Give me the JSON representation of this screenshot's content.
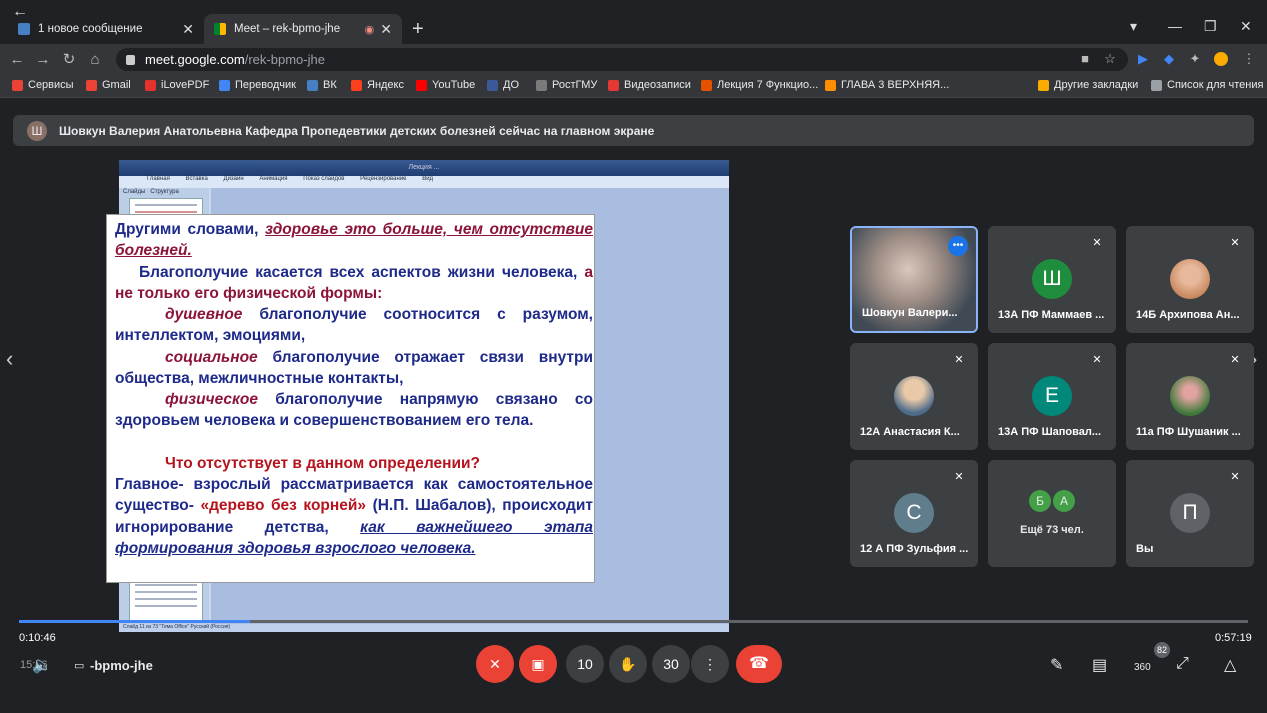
{
  "browser": {
    "tabs": [
      {
        "title": "1 новое сообщение",
        "favicon": "vk-icon",
        "color": "#4680c2"
      },
      {
        "title": "Meet – rek-bpmo-jhe",
        "favicon": "meet-icon",
        "color": "#00897b",
        "active": true
      }
    ],
    "url_host": "meet.google.com",
    "url_path": "/rek-bpmo-jhe",
    "bookmarks": [
      {
        "label": "Сервисы",
        "color": "#ea4335"
      },
      {
        "label": "Gmail",
        "color": "#ea4335"
      },
      {
        "label": "iLovePDF",
        "color": "#e5322d"
      },
      {
        "label": "Переводчик",
        "color": "#4285f4"
      },
      {
        "label": "ВК",
        "color": "#4680c2"
      },
      {
        "label": "Яндекс",
        "color": "#fc3f1d"
      },
      {
        "label": "YouTube",
        "color": "#ff0000"
      },
      {
        "label": "ДО",
        "color": "#3b5998"
      },
      {
        "label": "РостГМУ",
        "color": "#7a7a7a"
      },
      {
        "label": "Видеозаписи",
        "color": "#e53935"
      },
      {
        "label": "Лекция 7 Функцио...",
        "color": "#e65100"
      },
      {
        "label": "ГЛАВА 3 ВЕРХНЯЯ...",
        "color": "#ff8f00"
      },
      {
        "label": "Другие закладки",
        "color": "#f9ab00"
      },
      {
        "label": "Список для чтения",
        "color": "#9aa0a6"
      }
    ]
  },
  "banner": {
    "avatar_letter": "Ш",
    "text": "Шовкун Валерия Анатольевна Кафедра Пропедевтики детских болезней сейчас на главном экране"
  },
  "powerpoint": {
    "title": "Лекция ...",
    "ribbon": [
      "Главная",
      "Вставка",
      "Дизайн",
      "Анимация",
      "Показ слайдов",
      "Рецензирование",
      "Вид"
    ],
    "panel_tabs": [
      "Слайды",
      "Структура"
    ],
    "thumbs": [
      "10",
      "11",
      "12",
      "13",
      "14"
    ],
    "status": "Слайд 11 из 73   \"Тема Office\"   Русский (Россия)"
  },
  "slide": {
    "l1a": "Другими словами, ",
    "l1b": "здоровье это больше, чем отсутствие болезней.",
    "l2a": "Благополучие касается всех аспектов жизни человека, ",
    "l2b": "а не только его физической формы:",
    "l3a": "душевное",
    "l3b": " благополучие соотносится с разумом, интеллектом, эмоциями,",
    "l4a": "социальное",
    "l4b": " благополучие отражает связи внутри общества, межличностные контакты,",
    "l5a": "физическое",
    "l5b": " благополучие напрямую связано со здоровьем человека и совершенствованием его тела.",
    "l6": "Что отсутствует в данном определении?",
    "l7a": "Главное- взрослый рассматривается как самостоятельное существо- ",
    "l7b": "«дерево без корней»",
    "l7c": " (Н.П. Шабалов), происходит игнорирование детства, ",
    "l7d": "как важнейшего этапа формирования здоровья взрослого человека."
  },
  "participants": [
    {
      "name": "Шовкун Валери...",
      "type": "video",
      "speaking": true
    },
    {
      "name": "13А ПФ Маммаев ...",
      "letter": "Ш",
      "color": "#1e8e3e",
      "muted": true
    },
    {
      "name": "14Б Архипова Ан...",
      "type": "photo",
      "muted": true
    },
    {
      "name": "12А Анастасия К...",
      "type": "photo",
      "muted": true
    },
    {
      "name": "13А ПФ Шаповал...",
      "letter": "Е",
      "color": "#00897b",
      "muted": true
    },
    {
      "name": "11а ПФ Шушаник ...",
      "type": "photo",
      "muted": true
    },
    {
      "name": "12 А ПФ Зульфия ...",
      "letter": "С",
      "color": "#607d8b",
      "muted": true
    },
    {
      "name": "Ещё 73 чел.",
      "letters": [
        "Б",
        "А"
      ],
      "color": "#43a047"
    },
    {
      "name": "Вы",
      "letter": "П",
      "color": "#5f6368",
      "muted": true
    }
  ],
  "player": {
    "elapsed": "0:10:46",
    "total": "0:57:19",
    "progress": 0.188,
    "time_left": "15:06",
    "meeting_code": "-bpmo-jhe",
    "rewind_label": "10",
    "forward_label": "30",
    "speed_label": "360",
    "people_count": "82"
  }
}
